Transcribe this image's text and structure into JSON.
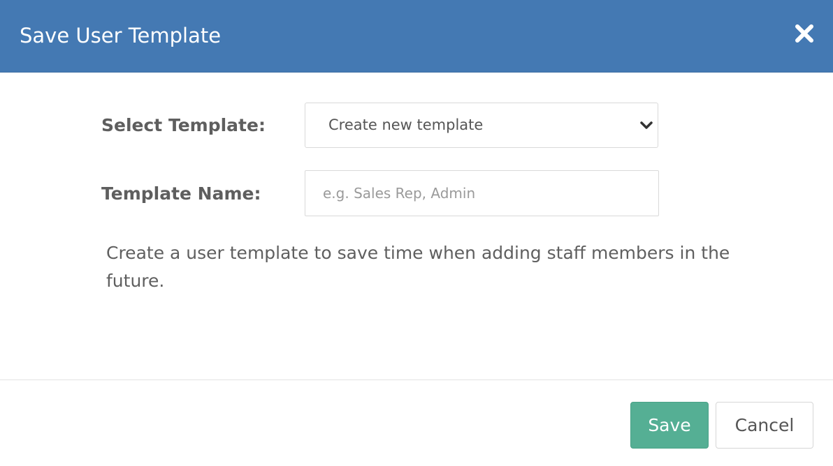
{
  "modal": {
    "title": "Save User Template",
    "close_icon": "close-icon"
  },
  "form": {
    "select_template": {
      "label": "Select Template:",
      "selected_value": "Create new template",
      "icon": "chevron-down-icon"
    },
    "template_name": {
      "label": "Template Name:",
      "value": "",
      "placeholder": "e.g. Sales Rep, Admin"
    },
    "help_text": "Create a user template to save time when adding staff members in the future."
  },
  "footer": {
    "save_label": "Save",
    "cancel_label": "Cancel"
  },
  "colors": {
    "header": "#4479b3",
    "save_button": "#55af94"
  }
}
